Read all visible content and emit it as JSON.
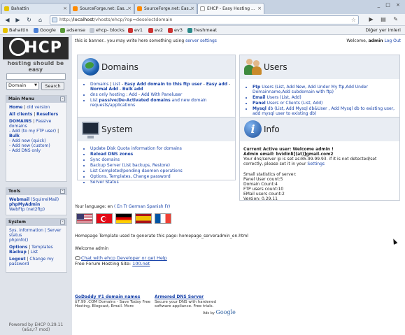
{
  "browser": {
    "tabs": [
      {
        "label": "Bahattin",
        "active": false,
        "icon": "bookmark-icon"
      },
      {
        "label": "SourceForge.net: Eas...",
        "active": false,
        "icon": "sourceforge-icon"
      },
      {
        "label": "SourceForge.net: Eas...",
        "active": false,
        "icon": "sourceforge-icon"
      },
      {
        "label": "EHCP - Easy Hosting ...",
        "active": true,
        "icon": "page-icon"
      }
    ],
    "tab_close": "×",
    "window_buttons": "_ □ ×",
    "url_host": "localhost",
    "url_path": "/vhosts/ehcp/?op=deselectdomain",
    "url_prefix": "http://",
    "nav": {
      "back": "◀",
      "forward": "▶",
      "reload": "↻",
      "home": "⌂"
    },
    "star": "☆",
    "toolbar_right": "▶ ▤ ✎",
    "bookmarks": [
      "Bahattin",
      "Google",
      "adsense",
      "ehcp- blocks",
      "ev1",
      "ev2",
      "ev3",
      "freshmeat"
    ],
    "bookmarks_more": "Diğer yer imleri"
  },
  "sidebar": {
    "logo_text": "HCP",
    "tagline": "hosting should be easy",
    "search_select": "Domain",
    "search_button": "Search",
    "main_menu": {
      "title": "Main Menu",
      "home": "Home",
      "sep1": " | ",
      "old_version": "old version",
      "all_clients": "All clients",
      "resellers": "Resellers",
      "domains": "DOMAINS",
      "passive_domains": "Passive domains",
      "add_line1": "- Add (to my FTP user)",
      "bulk": "Bulk",
      "add_line2": "- Add new (quick)",
      "add_line3": "- Add new (custom)",
      "add_line4": "- Add DNS only"
    },
    "tools": {
      "title": "Tools",
      "webmail": "Webmail",
      "webmail_suffix": "(SquirrelMail)",
      "phpmyadmin": "phpMyAdmin",
      "webftp": "WebFtp (net2ftp)"
    },
    "system": {
      "title": "System",
      "sys_info": "Sys. information | Server status",
      "phpinfo": "phpinfo()",
      "options": "Options",
      "templates": "Templates",
      "backup": "Backup",
      "list": "List",
      "logout": "Logout",
      "change_pw": "Change my password"
    },
    "powered_line1": "Powered by EHCP 0.29.11",
    "powered_line2": "(a&s,r7 mod)"
  },
  "main": {
    "banner_text": "this is banner.. you may write here something using",
    "banner_link": "server settings",
    "welcome_prefix": "Welcome,",
    "welcome_user": "admin",
    "logout": "Log Out",
    "domains": {
      "title": "Domains",
      "line1_a": "Domains",
      "line1_b": "List",
      "line1_c": "Easy Add domain to this ftp user",
      "line1_d": "Easy add",
      "line1_e": "Normal Add",
      "line1_f": "Bulk add",
      "line2_a": "dns only hosting",
      "line2_b": "Add",
      "line2_c": "Add With Paneluser",
      "line3_a": "List",
      "line3_b": "passive/De-Activated domains",
      "line3_c": "and new domain requests/applications"
    },
    "users": {
      "title": "Users",
      "ftp_label": "Ftp",
      "ftp_links": "Users (List, Add New, Add Under My ftp,Add Under Domainname,Add subdomain with ftp)",
      "email_label": "Email",
      "email_links": "Users (List, Add)",
      "panel_label": "Panel",
      "panel_links": "Users or Clients (List, Add)",
      "mysql_label": "Mysql",
      "mysql_links": "db (List, Add Mysql db&User , Add Mysql db to existing user, add mysql user to existing db)"
    },
    "system": {
      "title": "System",
      "items": [
        "Update Disk Quota information for domains",
        "Reload DNS zones",
        "Sync domains",
        "Backup Server (List backups, Restore)",
        "List Completed/pending daemon operations",
        "Options, Templates, Change password",
        "Server Status"
      ]
    },
    "info": {
      "title": "Info",
      "line1": "Current Active user: Welcome admin !",
      "line2": "Admin email: bvidinli[(at)]gmail.com2",
      "line3": "Your dns/server ip is set as:85.99.99.93. if it is not detected/set correctly, please set it in your",
      "line3_link": "Settings",
      "stats_title": "Small statistics of server:",
      "stats": [
        "Panel User count:5",
        "Domain Count:4",
        "FTP users count:10",
        "EMail users count:2",
        "Version: 0.29.11"
      ]
    },
    "language": {
      "label": "Your language: en",
      "links": "( En Tr German Spanish Fr)"
    },
    "flags": [
      "us-flag",
      "tr-flag",
      "de-flag",
      "es-flag",
      "fr-flag"
    ],
    "template_note": "Homepage Template used to generate this page: homepage_serveradmin_en.html",
    "welcome_admin": "Welcome admin",
    "chat_link": "Chat with ehcp Developer or get Help",
    "free_forum_label": "Free Forum Hosting Site:",
    "free_forum_link": "100.net",
    "ads": [
      {
        "title": "GoDaddy #1 domain names",
        "text": "$7.99 .COM Domains - Save Today Free Hosting, Blogcast, Email. More"
      },
      {
        "title": "Armored DNS Server",
        "text": "Secure your DNS with hardened software appliance. Free trials."
      }
    ],
    "ads_by": "Ads by",
    "ads_by_brand": "Google"
  },
  "colors": {
    "link": "#1a44aa",
    "sidebar_bg": "#dfe3ea",
    "box_header": "#e9edf3"
  }
}
